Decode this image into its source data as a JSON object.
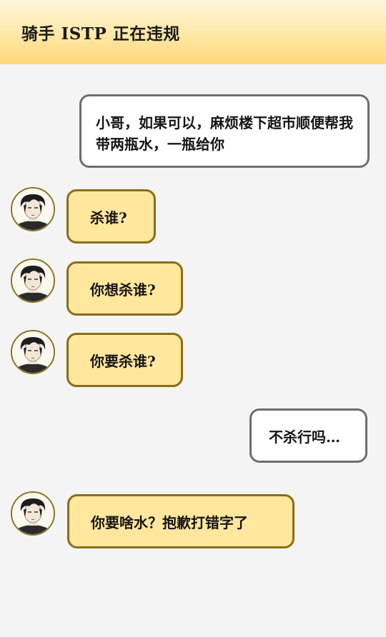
{
  "header": {
    "title": "骑手 ISTP 正在违规"
  },
  "messages": [
    {
      "sender": "me",
      "text": "小哥，如果可以，麻烦楼下超市顺便帮我带两瓶水，一瓶给你"
    },
    {
      "sender": "rider",
      "text": "杀谁?"
    },
    {
      "sender": "rider",
      "text": "你想杀谁?"
    },
    {
      "sender": "rider",
      "text": "你要杀谁?"
    },
    {
      "sender": "me",
      "text": "不杀行吗…"
    },
    {
      "sender": "rider",
      "text": "你要啥水？抱歉打错字了"
    }
  ],
  "colors": {
    "header_gradient_top": "#fff6dc",
    "header_gradient_bottom": "#ffd87a",
    "rider_bubble": "#ffe79e",
    "rider_bubble_border": "#8a6d16",
    "me_bubble": "#ffffff",
    "me_bubble_border": "#6e6e6e",
    "background": "#f4f4f4"
  },
  "icons": {
    "avatar": "rider-avatar-icon"
  }
}
